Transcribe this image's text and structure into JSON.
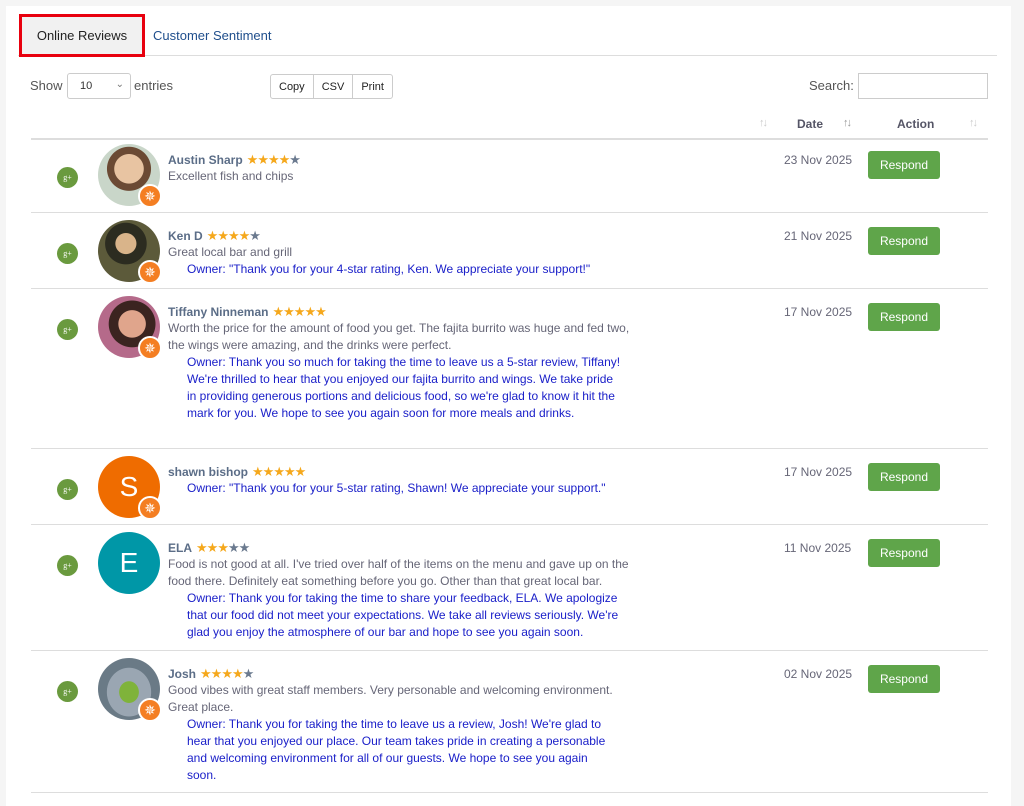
{
  "tabs": [
    {
      "label": "Online Reviews"
    },
    {
      "label": "Customer Sentiment"
    }
  ],
  "controls": {
    "show_label": "Show",
    "entries_value": "10",
    "entries_label": "entries",
    "export_buttons": [
      "Copy",
      "CSV",
      "Print"
    ],
    "search_label": "Search:",
    "search_value": ""
  },
  "columns": {
    "date": "Date",
    "action": "Action"
  },
  "reviews": [
    {
      "name": "Austin Sharp",
      "rating": 4,
      "text": "Excellent fish and chips",
      "owner": "",
      "date": "23 Nov 2025",
      "action": "Respond",
      "avatar_color": "#b98a6b"
    },
    {
      "name": "Ken D",
      "rating": 4,
      "text": "Great local bar and grill",
      "owner": "Owner: \"Thank you for your 4-star rating, Ken. We appreciate your support!\"",
      "date": "21 Nov 2025",
      "action": "Respond",
      "avatar_color": "#4a4a30"
    },
    {
      "name": "Tiffany Ninneman",
      "rating": 5,
      "text": "Worth the price for the amount of food you get. The fajita burrito was huge and fed two, the wings were amazing, and the drinks were perfect.",
      "owner": "Owner: Thank you so much for taking the time to leave us a 5-star review, Tiffany! We're thrilled to hear that you enjoyed our fajita burrito and wings. We take pride in providing generous portions and delicious food, so we're glad to know it hit the mark for you. We hope to see you again soon for more meals and drinks.",
      "date": "17 Nov 2025",
      "action": "Respond",
      "avatar_color": "#8a4f63"
    },
    {
      "name": "shawn bishop",
      "rating": 5,
      "text": "",
      "owner": "Owner: \"Thank you for your 5-star rating, Shawn! We appreciate your support.\"",
      "date": "17 Nov 2025",
      "action": "Respond",
      "avatar_letter": "S",
      "avatar_color": "#ef6c00"
    },
    {
      "name": "ELA",
      "rating": 3,
      "text": "Food is not good at all. I've tried over half of the items on the menu and gave up on the food there. Definitely eat something before you go. Other than that great local bar.",
      "owner": "Owner: Thank you for taking the time to share your feedback, ELA. We apologize that our food did not meet your expectations. We take all reviews seriously. We're glad you enjoy the atmosphere of our bar and hope to see you again soon.",
      "date": "11 Nov 2025",
      "action": "Respond",
      "avatar_letter": "E",
      "avatar_color": "#0097a7"
    },
    {
      "name": "Josh",
      "rating": 4,
      "text": "Good vibes with great staff members. Very personable and welcoming environment. Great place.",
      "owner": "Owner: Thank you for taking the time to leave us a review, Josh! We're glad to hear that you enjoyed our place. Our team takes pride in creating a personable and welcoming environment for all of our guests. We hope to see you again soon.",
      "date": "02 Nov 2025",
      "action": "Respond",
      "avatar_color": "#7d9a6a"
    }
  ]
}
